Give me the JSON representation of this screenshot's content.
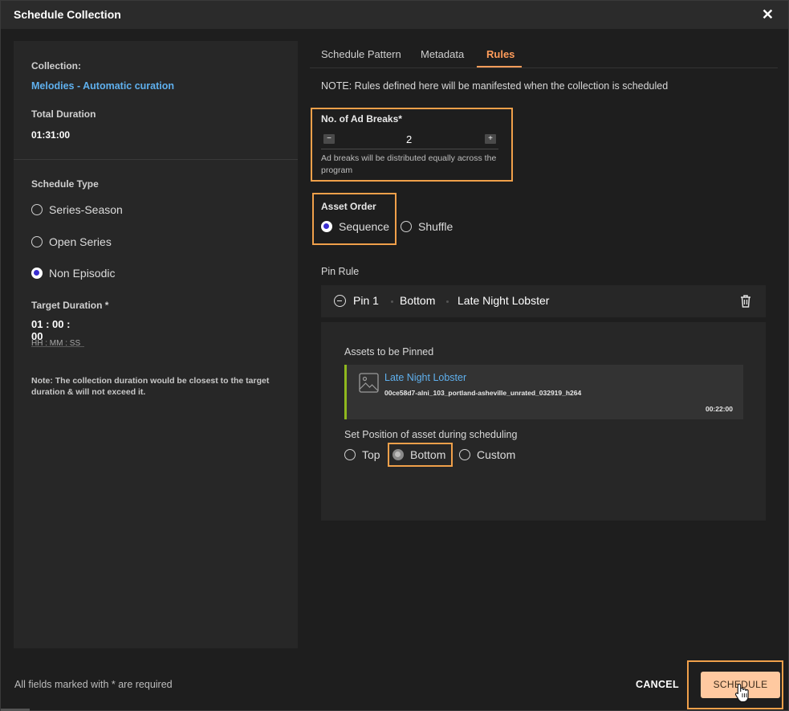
{
  "dialog": {
    "title": "Schedule Collection"
  },
  "left": {
    "collection_label": "Collection:",
    "collection_name": "Melodies - Automatic curation",
    "total_duration_label": "Total Duration",
    "total_duration_value": "01:31:00",
    "schedule_type_label": "Schedule Type",
    "schedule_types": [
      {
        "label": "Series-Season",
        "selected": false
      },
      {
        "label": "Open Series",
        "selected": false
      },
      {
        "label": "Non Episodic",
        "selected": true
      }
    ],
    "target_duration_label": "Target Duration *",
    "target_duration_value": "01 : 00 : 00",
    "target_duration_hint": "HH : MM : SS",
    "note": "Note: The collection duration would be closest to the target duration & will not exceed it."
  },
  "tabs": [
    {
      "label": "Schedule Pattern",
      "active": false
    },
    {
      "label": "Metadata",
      "active": false
    },
    {
      "label": "Rules",
      "active": true
    }
  ],
  "rules": {
    "note": "NOTE: Rules defined here will be manifested when the collection is scheduled",
    "ad_breaks": {
      "label": "No. of Ad Breaks*",
      "value": "2",
      "minus": "−",
      "plus": "+",
      "hint": "Ad breaks will be distributed equally across the program"
    },
    "asset_order": {
      "label": "Asset Order",
      "options": [
        {
          "label": "Sequence",
          "selected": true
        },
        {
          "label": "Shuffle",
          "selected": false
        }
      ]
    },
    "pin_rule": {
      "label": "Pin Rule",
      "pin": {
        "name": "Pin 1",
        "position": "Bottom",
        "asset": "Late Night Lobster"
      },
      "assets_label": "Assets to be Pinned",
      "asset": {
        "title": "Late Night Lobster",
        "file": "00ce58d7-alni_103_portland-asheville_unrated_032919_h264",
        "duration": "00:22:00"
      },
      "set_position_label": "Set Position of asset during scheduling",
      "positions": [
        {
          "label": "Top",
          "selected": false
        },
        {
          "label": "Bottom",
          "selected": true
        },
        {
          "label": "Custom",
          "selected": false
        }
      ]
    }
  },
  "footer": {
    "required_note": "All fields marked with * are required",
    "cancel_label": "CANCEL",
    "schedule_label": "SCHEDULE"
  },
  "colors": {
    "accent": "#ff9c5a",
    "link": "#5fb0ee",
    "highlight": "#f0a04a",
    "primary_button": "#ffc9a0"
  }
}
